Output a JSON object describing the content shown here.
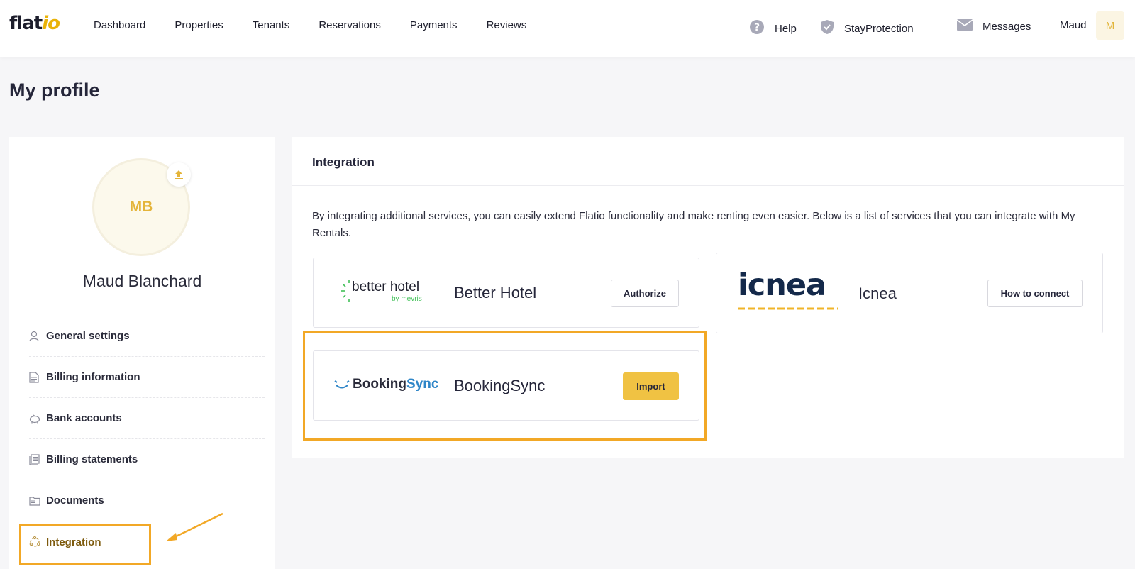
{
  "header": {
    "logo": {
      "main": "flat",
      "accent": "io"
    },
    "nav": [
      "Dashboard",
      "Properties",
      "Tenants",
      "Reservations",
      "Payments",
      "Reviews"
    ],
    "help_label": "Help",
    "help_icon": "question-circle-icon",
    "protection_label": "StayProtection",
    "protection_icon": "shield-check-icon",
    "messages_label": "Messages",
    "messages_icon": "envelope-icon",
    "user_name": "Maud",
    "user_initial": "M"
  },
  "page": {
    "title": "My profile"
  },
  "sidebar": {
    "initials": "MB",
    "upload_icon": "upload-icon",
    "name": "Maud Blanchard",
    "items": [
      {
        "label": "General settings",
        "icon": "user-icon",
        "active": false
      },
      {
        "label": "Billing information",
        "icon": "document-icon",
        "active": false
      },
      {
        "label": "Bank accounts",
        "icon": "piggy-bank-icon",
        "active": false
      },
      {
        "label": "Billing statements",
        "icon": "stack-icon",
        "active": false
      },
      {
        "label": "Documents",
        "icon": "folder-icon",
        "active": false
      },
      {
        "label": "Integration",
        "icon": "integration-icon",
        "active": true
      }
    ]
  },
  "integration": {
    "title": "Integration",
    "intro": "By integrating additional services, you can easily extend Flatio functionality and make renting even easier. Below is a list of services that you can integrate with My Rentals.",
    "services": [
      {
        "logo_text": "better hotel",
        "logo_sub": "by mevris",
        "name": "Better Hotel",
        "button": "Authorize"
      },
      {
        "logo_text": "icnea",
        "name": "Icnea",
        "button": "How to connect"
      },
      {
        "logo_main": "Booking",
        "logo_accent": "Sync",
        "name": "BookingSync",
        "button": "Import"
      }
    ]
  },
  "colors": {
    "accent": "#f0c243",
    "highlight": "#f2a826",
    "icnea_navy": "#14294a",
    "bookingsync_blue": "#2f86c8",
    "betterhotel_green": "#40c057"
  }
}
